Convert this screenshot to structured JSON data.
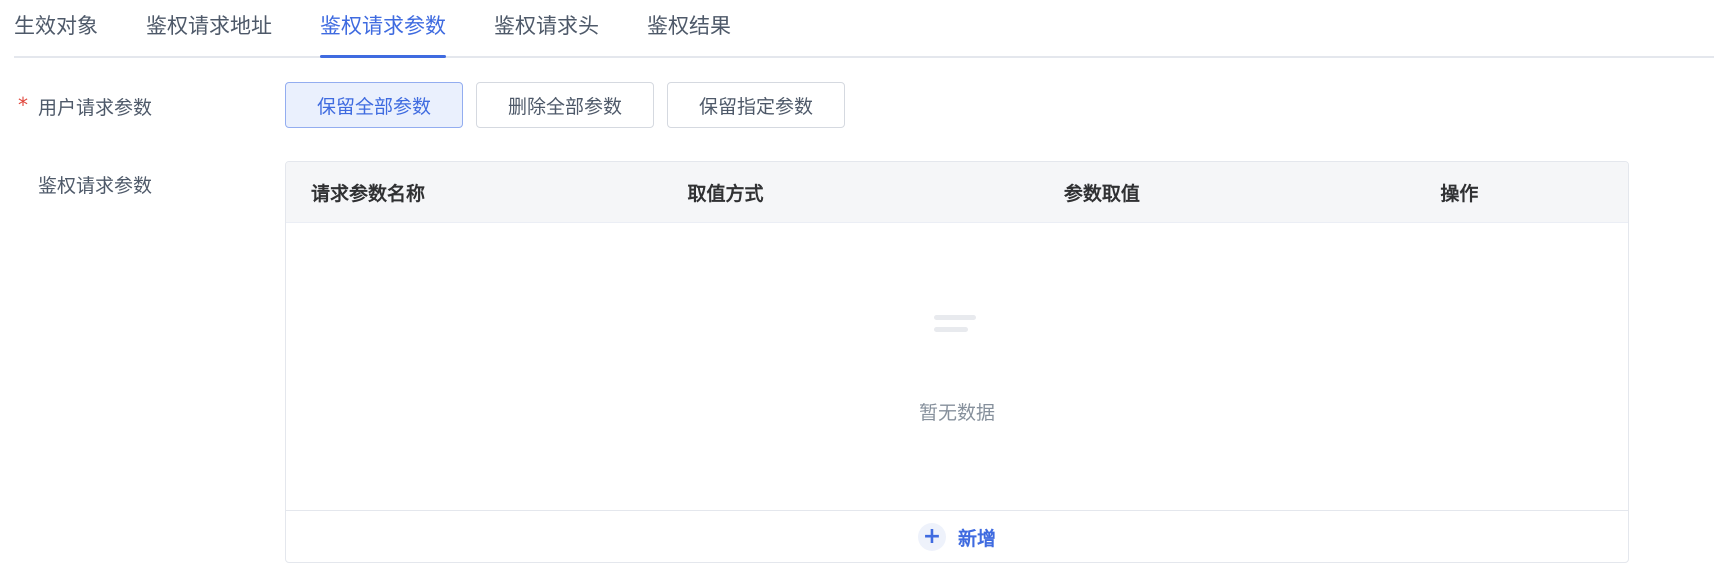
{
  "tabs": [
    {
      "label": "生效对象",
      "active": false
    },
    {
      "label": "鉴权请求地址",
      "active": false
    },
    {
      "label": "鉴权请求参数",
      "active": true
    },
    {
      "label": "鉴权请求头",
      "active": false
    },
    {
      "label": "鉴权结果",
      "active": false
    }
  ],
  "form": {
    "required_mark": "*",
    "user_params_label": "用户请求参数",
    "auth_params_label": "鉴权请求参数"
  },
  "param_options": [
    {
      "label": "保留全部参数",
      "selected": true
    },
    {
      "label": "删除全部参数",
      "selected": false
    },
    {
      "label": "保留指定参数",
      "selected": false
    }
  ],
  "table": {
    "columns": [
      "请求参数名称",
      "取值方式",
      "参数取值",
      "操作"
    ],
    "empty_text": "暂无数据",
    "empty_icon": "empty-data-icon",
    "add_icon": "plus-icon",
    "add_label": "新增"
  },
  "colors": {
    "accent": "#3f6be0",
    "required": "#e0463c",
    "text": "#303133",
    "muted": "#86909c"
  }
}
